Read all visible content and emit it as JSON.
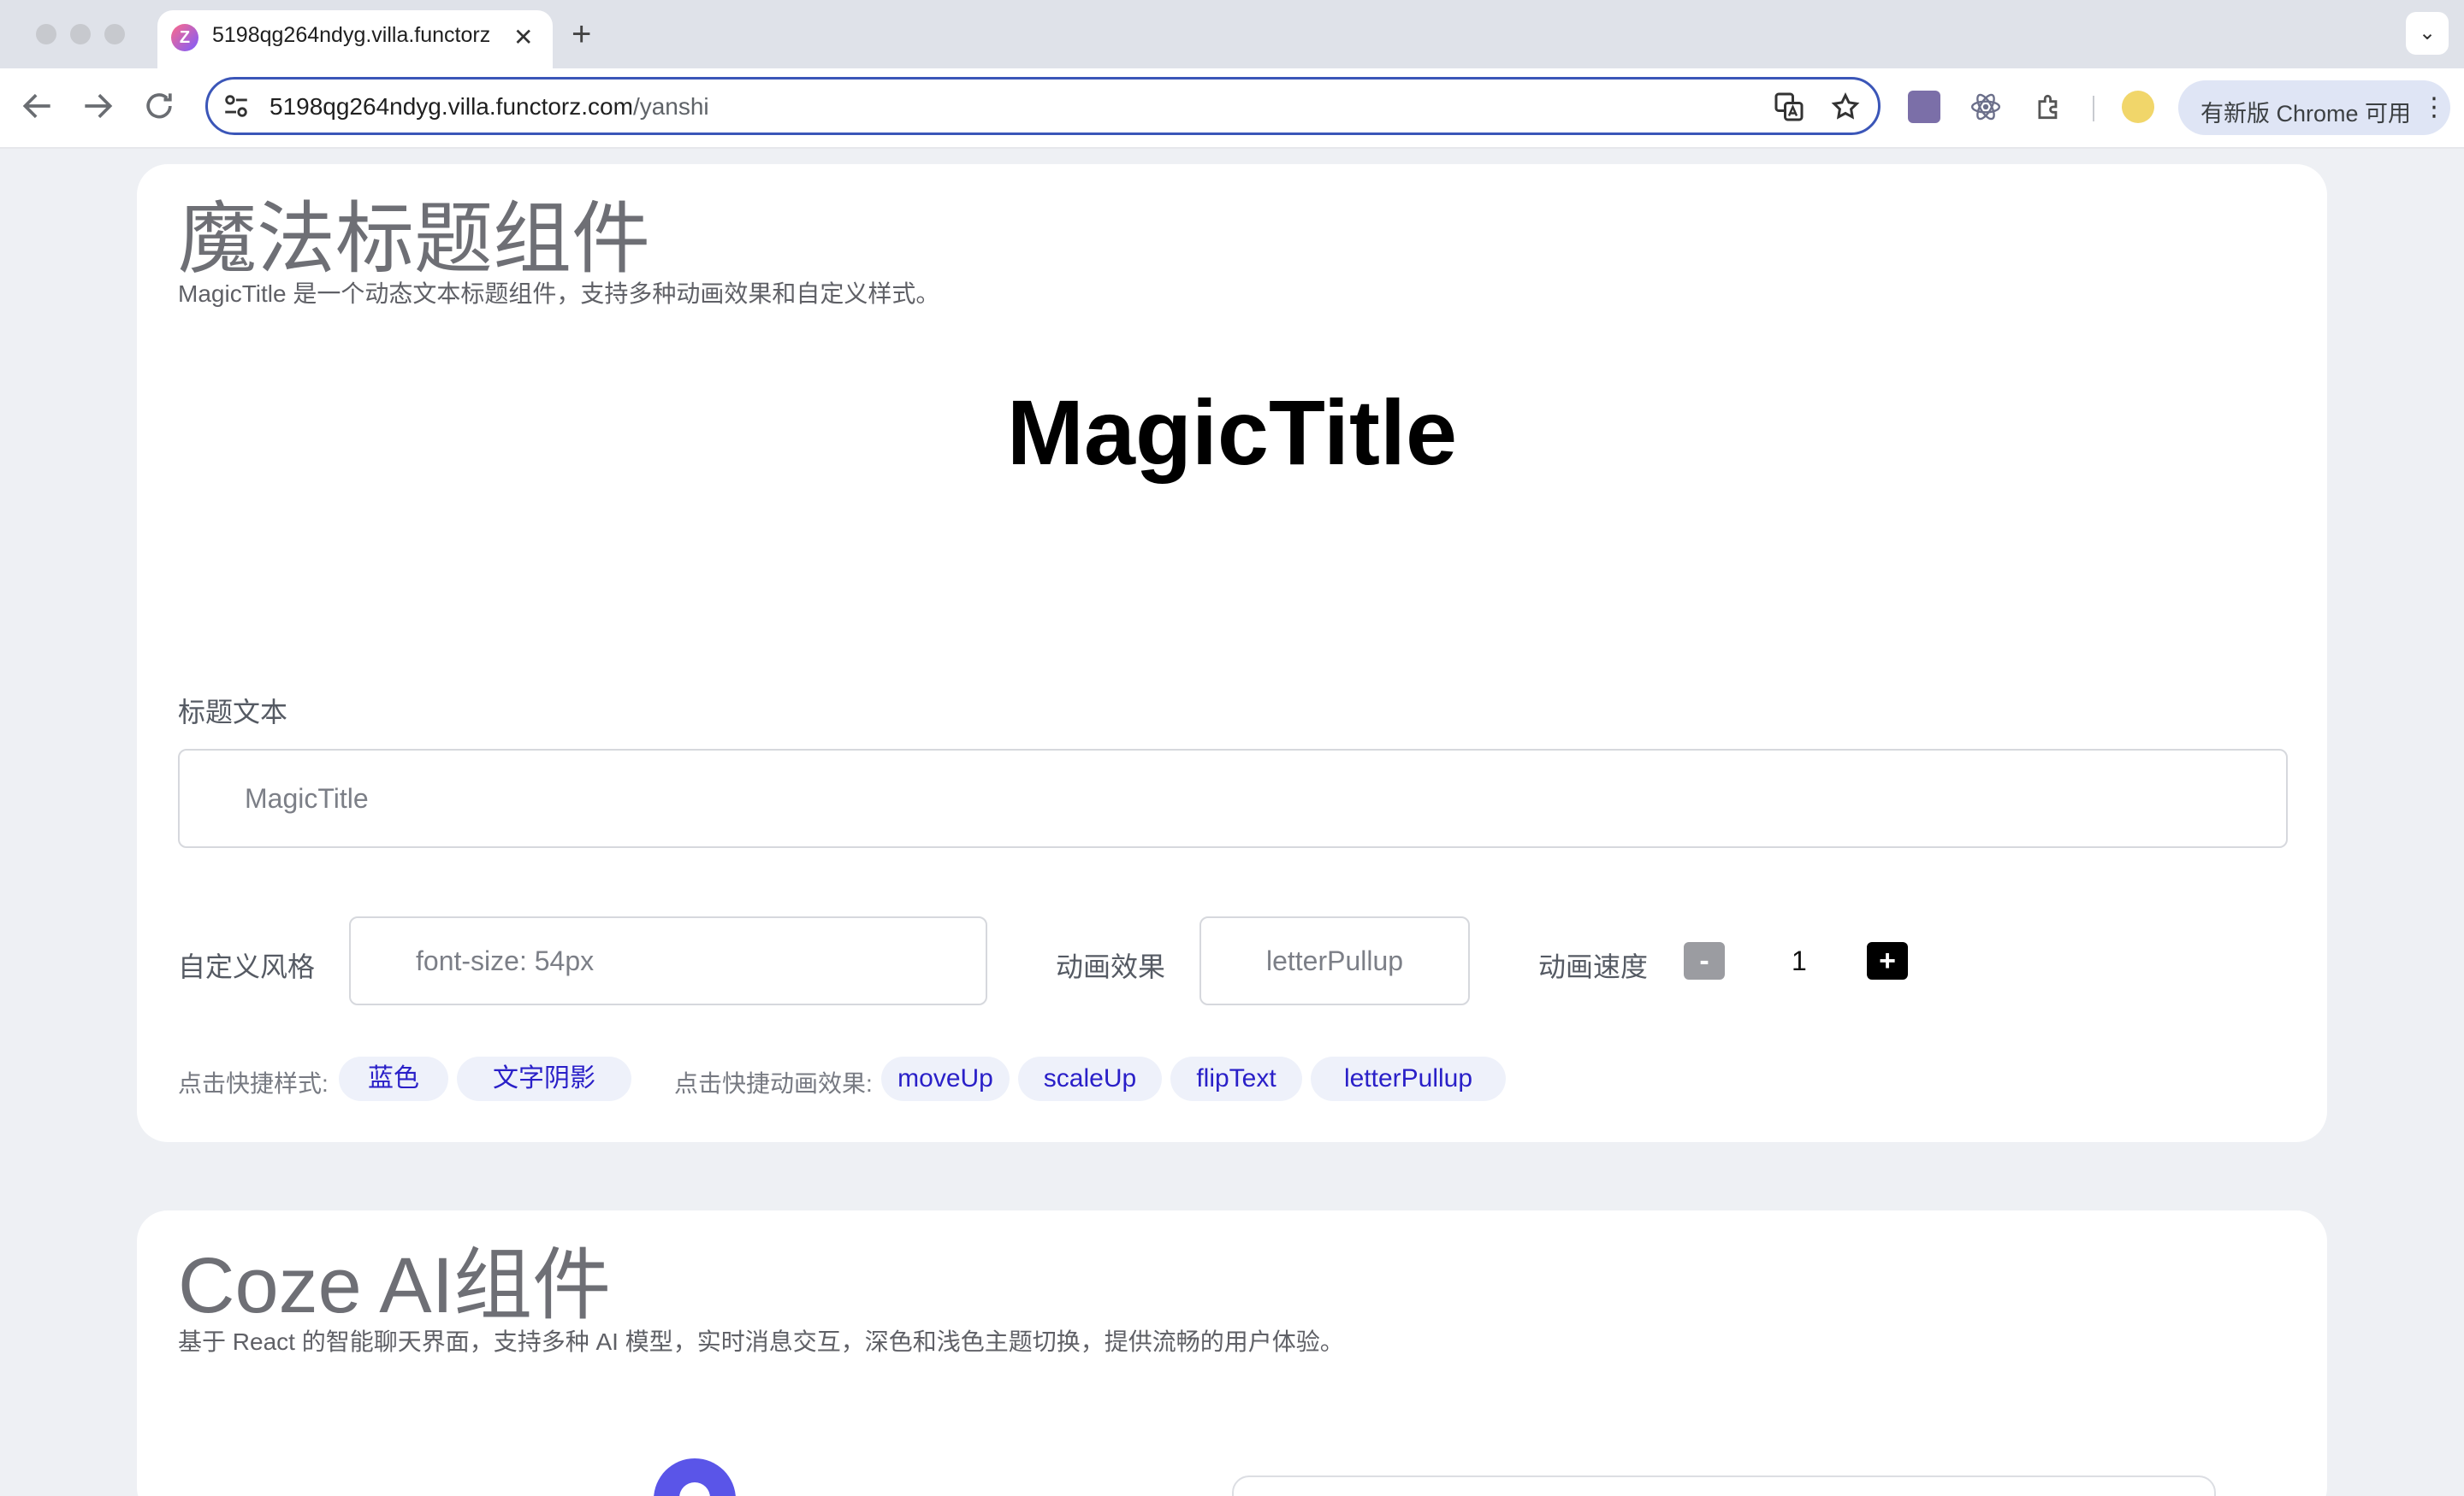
{
  "browser": {
    "tab_title": "5198qg264ndyg.villa.functorz",
    "tab_favicon": "Z",
    "new_tab_glyph": "+",
    "close_glyph": "✕",
    "menu_glyph": "⌄",
    "url_host": "5198qg264ndyg.villa.functorz.com",
    "url_path": "/yanshi",
    "update_label": "有新版 Chrome 可用",
    "extensions": [
      "ai-brain-icon",
      "react-icon",
      "puzzle-icon",
      "profile-avatar-icon"
    ]
  },
  "magic_title_section": {
    "heading": "魔法标题组件",
    "description": "MagicTitle 是一个动态文本标题组件，支持多种动画效果和自定义样式。",
    "preview_text": "MagicTitle",
    "title_text_label": "标题文本",
    "title_text_value": "MagicTitle",
    "custom_style_label": "自定义风格",
    "custom_style_value": "font-size: 54px",
    "animation_label": "动画效果",
    "animation_value": "letterPullup",
    "speed_label": "动画速度",
    "speed_minus": "-",
    "speed_value": "1",
    "speed_plus": "+",
    "quick_style_label": "点击快捷样式:",
    "quick_styles": [
      "蓝色",
      "文字阴影"
    ],
    "quick_anim_label": "点击快捷动画效果:",
    "quick_animations": [
      "moveUp",
      "scaleUp",
      "flipText",
      "letterPullup"
    ]
  },
  "coze_section": {
    "heading": "Coze AI组件",
    "description": "基于 React 的智能聊天界面，支持多种 AI 模型，实时消息交互，深色和浅色主题切换，提供流畅的用户体验。"
  },
  "colors": {
    "accent_border": "#3b56b8",
    "chip_text": "#2a20c8",
    "chip_bg": "#eef1fa",
    "coze_brand": "#5a55e8"
  }
}
